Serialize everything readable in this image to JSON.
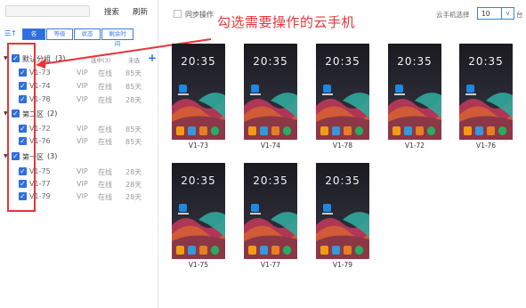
{
  "toolbar": {
    "search_label": "搜索",
    "refresh_label": "刷新"
  },
  "sort_tabs": [
    {
      "label": "名称",
      "active": true
    },
    {
      "label": "等级",
      "active": false
    },
    {
      "label": "状态",
      "active": false
    },
    {
      "label": "剩余时间",
      "active": false
    }
  ],
  "sort_icon": "sort-icon",
  "groups": [
    {
      "name": "默认分组",
      "count": "(3)",
      "selected_label": "选中(3)",
      "unselected_label": "未选",
      "items": [
        {
          "name": "V1-73",
          "level": "VIP",
          "status": "在线",
          "days": "85天"
        },
        {
          "name": "V1-74",
          "level": "VIP",
          "status": "在线",
          "days": "85天"
        },
        {
          "name": "V1-78",
          "level": "VIP",
          "status": "在线",
          "days": "28天"
        }
      ]
    },
    {
      "name": "第二区",
      "count": "(2)",
      "items": [
        {
          "name": "V1-72",
          "level": "VIP",
          "status": "在线",
          "days": "85天"
        },
        {
          "name": "V1-76",
          "level": "VIP",
          "status": "在线",
          "days": "85天"
        }
      ]
    },
    {
      "name": "第一区",
      "count": "(3)",
      "items": [
        {
          "name": "V1-75",
          "level": "VIP",
          "status": "在线",
          "days": "28天"
        },
        {
          "name": "V1-77",
          "level": "VIP",
          "status": "在线",
          "days": "28天"
        },
        {
          "name": "V1-79",
          "level": "VIP",
          "status": "在线",
          "days": "28天"
        }
      ]
    }
  ],
  "sync_label": "同步操作",
  "annotation": "勾选需要操作的云手机",
  "select_label": "云手机选择",
  "select_value": "10",
  "unit_label": "台",
  "phone_clock": "20:35",
  "phones": [
    {
      "name": "V1-73"
    },
    {
      "name": "V1-74"
    },
    {
      "name": "V1-78"
    },
    {
      "name": "V1-72"
    },
    {
      "name": "V1-76"
    },
    {
      "name": "V1-75"
    },
    {
      "name": "V1-77"
    },
    {
      "name": "V1-79"
    }
  ],
  "colors": {
    "accent": "#2f6fde",
    "annotation": "#e8343a"
  }
}
